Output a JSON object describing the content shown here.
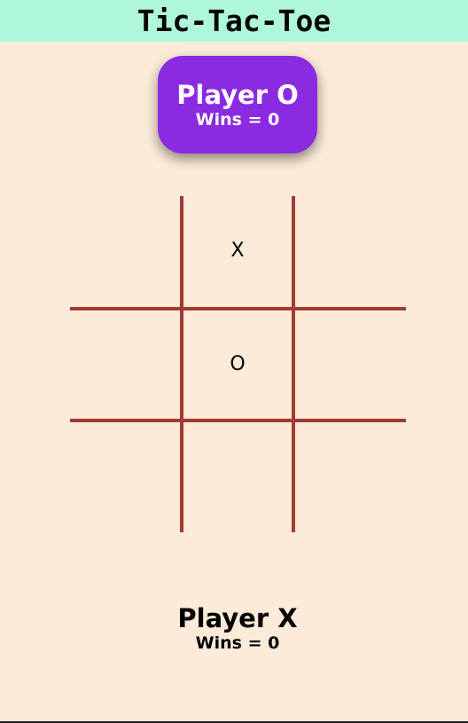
{
  "title": "Tic-Tac-Toe",
  "colors": {
    "background": "#fbebd8",
    "header": "#aef7d8",
    "active_player": "#8a2be2",
    "grid": "#a33a32"
  },
  "players": {
    "o": {
      "name": "Player O",
      "wins": "Wins = 0",
      "active": true
    },
    "x": {
      "name": "Player X",
      "wins": "Wins = 0",
      "active": false
    }
  },
  "board": {
    "cells": [
      "",
      "X",
      "",
      "",
      "O",
      "",
      "",
      "",
      ""
    ]
  }
}
